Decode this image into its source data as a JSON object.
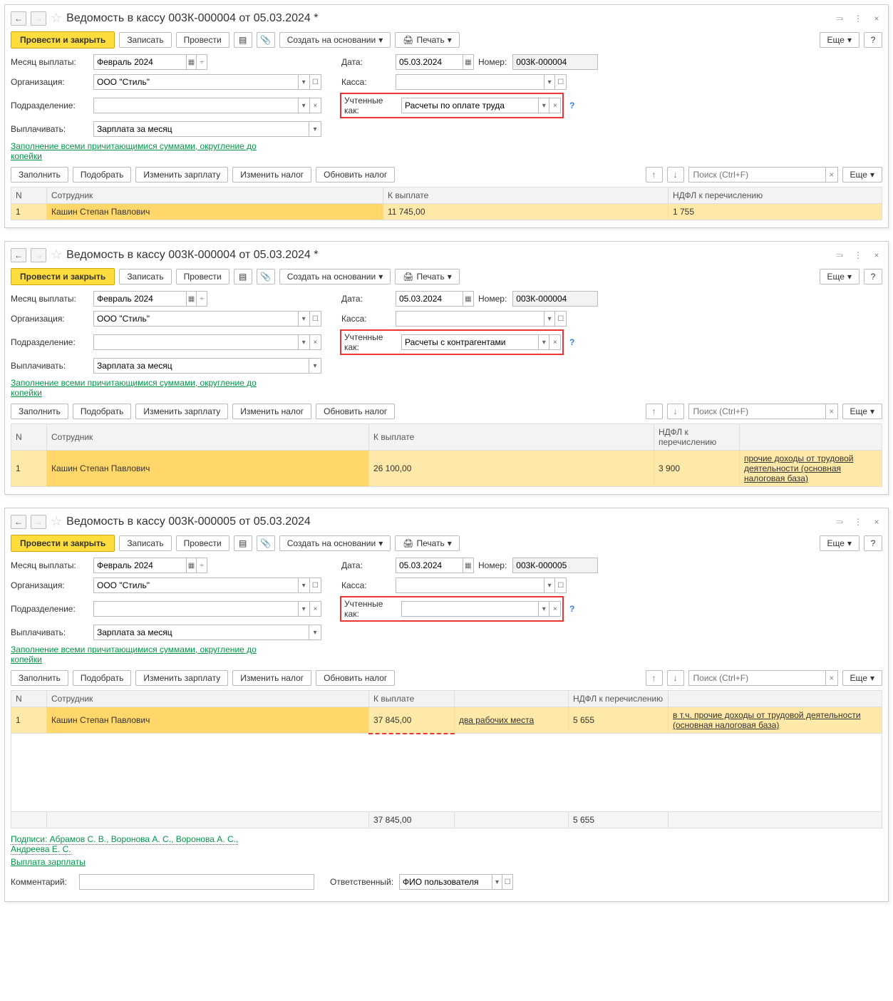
{
  "common": {
    "btn_post_close": "Провести и закрыть",
    "btn_record": "Записать",
    "btn_post": "Провести",
    "btn_create_base": "Создать на основании",
    "btn_print": "Печать",
    "btn_more": "Еще",
    "lbl_month": "Месяц выплаты:",
    "lbl_date": "Дата:",
    "lbl_number": "Номер:",
    "lbl_org": "Организация:",
    "org_val": "ООО \"Стиль\"",
    "lbl_kassa": "Касса:",
    "lbl_subdiv": "Подразделение:",
    "lbl_uch": "Учтенные как:",
    "lbl_pay": "Выплачивать:",
    "pay_val": "Зарплата за месяц",
    "month_val": "Февраль 2024",
    "date_val": "05.03.2024",
    "link_fill": "Заполнение всеми причитающимися суммами, округление до копейки",
    "btn_fill": "Заполнить",
    "btn_pick": "Подобрать",
    "btn_zp": "Изменить зарплату",
    "btn_tax": "Изменить налог",
    "btn_updtax": "Обновить налог",
    "search_ph": "Поиск (Ctrl+F)",
    "col_n": "N",
    "col_emp": "Сотрудник",
    "col_sum": "К выплате",
    "col_ndfl": "НДФЛ к перечислению"
  },
  "w1": {
    "title": "Ведомость в кассу 003К-000004 от 05.03.2024 *",
    "num": "003К-000004",
    "uch": "Расчеты по оплате труда",
    "row": {
      "n": "1",
      "emp": "Кашин Степан Павлович",
      "sum": "11 745,00",
      "ndfl": "1 755"
    }
  },
  "w2": {
    "title": "Ведомость в кассу 003К-000004 от 05.03.2024 *",
    "num": "003К-000004",
    "uch": "Расчеты с контрагентами",
    "row": {
      "n": "1",
      "emp": "Кашин Степан Павлович",
      "sum": "26 100,00",
      "ndfl": "3 900",
      "extra": "прочие доходы от трудовой деятельности (основная налоговая база)"
    }
  },
  "w3": {
    "title": "Ведомость в кассу 003К-000005 от 05.03.2024",
    "num": "003К-000005",
    "uch": "",
    "col_extra1": "",
    "row": {
      "n": "1",
      "emp": "Кашин Степан Павлович",
      "sum": "37 845,00",
      "extra1": "два рабочих места",
      "ndfl": "5 655",
      "extra2": "в т.ч. прочие доходы от трудовой деятельности (основная налоговая база)"
    },
    "totals": {
      "sum": "37 845,00",
      "ndfl": "5 655"
    },
    "link_sign": "Подписи: Абрамов С. В., Воронова А. С., Воронова А. С., Андреева Е. С.",
    "link_payout": "Выплата зарплаты",
    "lbl_comment": "Комментарий:",
    "lbl_resp": "Ответственный:",
    "resp_val": "ФИО пользователя"
  }
}
